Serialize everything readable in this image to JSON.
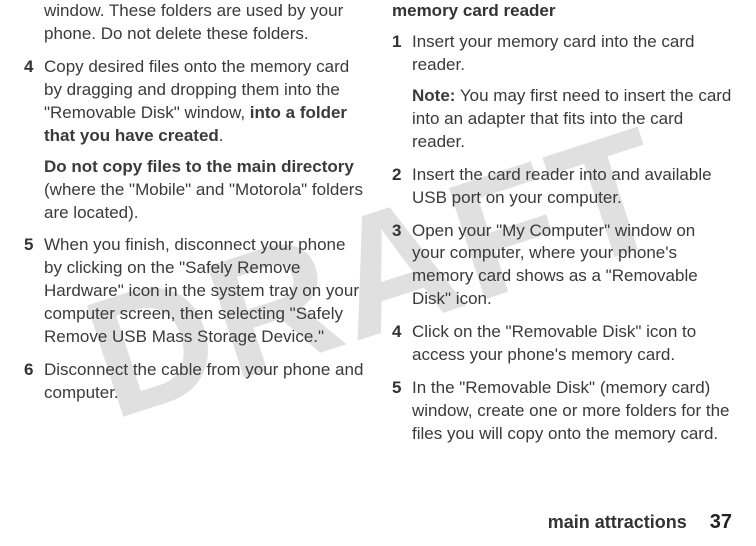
{
  "watermark": "DRAFT",
  "left": {
    "intro_tail": "window. These folders are used by your phone. Do not delete these folders.",
    "step4_a": "Copy desired files onto the memory card by dragging and dropping them into the \"Removable Disk\" window, ",
    "step4_b_bold": "into a folder that you have created",
    "step4_c": ".",
    "step4_sub_bold": "Do not copy files to the main directory",
    "step4_sub_rest": " (where the \"Mobile\" and \"Motorola\" folders are located).",
    "step5": "When you finish, disconnect your phone by clicking on the \"Safely Remove Hardware\" icon in the system tray on your computer screen, then selecting \"Safely Remove USB Mass Storage Device.\"",
    "step6": "Disconnect the cable from your phone and computer.",
    "n4": "4",
    "n5": "5",
    "n6": "6"
  },
  "right": {
    "heading": "memory card reader",
    "step1": "Insert your memory card into the card reader.",
    "step1_note_label": "Note:",
    "step1_note_rest": " You may first need to insert the card into an adapter that fits into the card reader.",
    "step2": "Insert the card reader into and available USB port on your computer.",
    "step3": "Open your \"My Computer\" window on your computer, where your phone's memory card shows as a \"Removable Disk\" icon.",
    "step4": "Click on the \"Removable Disk\" icon to access your phone's memory card.",
    "step5": "In the \"Removable Disk\" (memory card) window, create one or more folders for the files you will copy onto the memory card.",
    "n1": "1",
    "n2": "2",
    "n3": "3",
    "n4": "4",
    "n5": "5"
  },
  "footer": {
    "section": "main attractions",
    "page": "37"
  }
}
